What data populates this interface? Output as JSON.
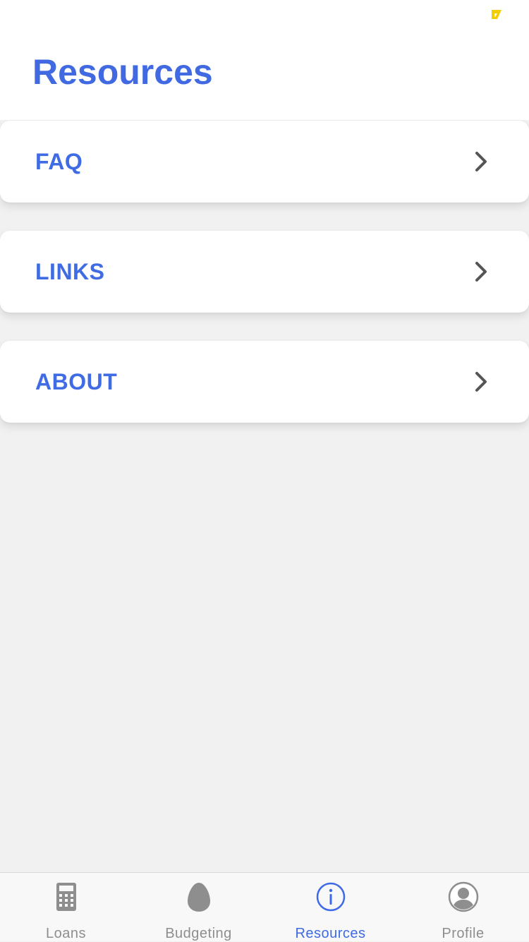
{
  "header": {
    "title": "Resources"
  },
  "menu": {
    "items": [
      {
        "label": "FAQ",
        "icon": "chevron-right-icon"
      },
      {
        "label": "LINKS",
        "icon": "chevron-right-icon"
      },
      {
        "label": "ABOUT",
        "icon": "chevron-right-icon"
      }
    ]
  },
  "tab_bar": {
    "tabs": [
      {
        "label": "Loans",
        "icon": "calculator-icon",
        "active": false
      },
      {
        "label": "Budgeting",
        "icon": "egg-icon",
        "active": false
      },
      {
        "label": "Resources",
        "icon": "info-icon",
        "active": true
      },
      {
        "label": "Profile",
        "icon": "profile-icon",
        "active": false
      }
    ]
  },
  "colors": {
    "accent": "#4169e1",
    "inactive": "#8e8e8e",
    "background": "#f1f1f1",
    "battery": "#f5cc00"
  }
}
